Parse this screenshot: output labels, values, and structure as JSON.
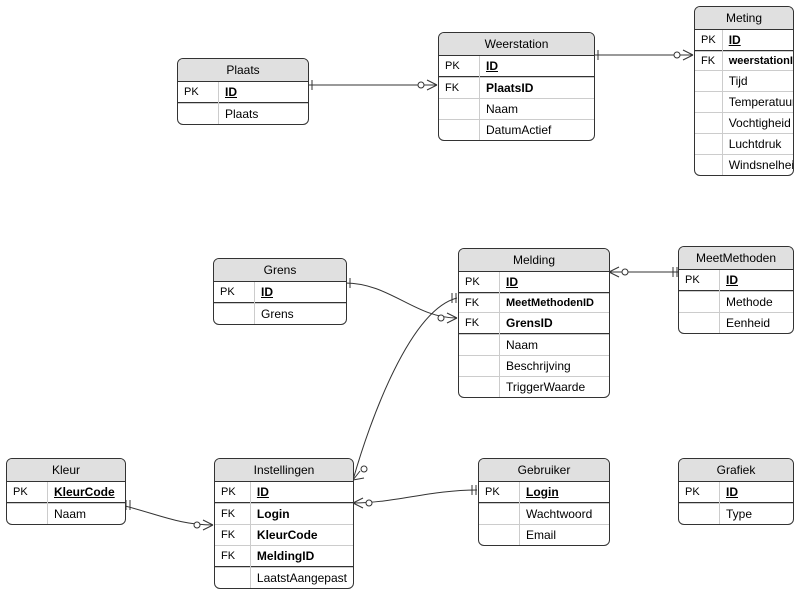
{
  "entities": {
    "plaats": {
      "title": "Plaats",
      "rows": [
        {
          "key": "PK",
          "name": "ID",
          "pk": true
        },
        {
          "key": "",
          "name": "Plaats"
        }
      ]
    },
    "weerstation": {
      "title": "Weerstation",
      "rows": [
        {
          "key": "PK",
          "name": "ID",
          "pk": true
        },
        {
          "key": "FK",
          "name": "PlaatsID",
          "fk": true
        },
        {
          "key": "",
          "name": "Naam"
        },
        {
          "key": "",
          "name": "DatumActief"
        }
      ]
    },
    "meting": {
      "title": "Meting",
      "rows": [
        {
          "key": "PK",
          "name": "ID",
          "pk": true
        },
        {
          "key": "FK",
          "name": "weerstationID",
          "fk": true
        },
        {
          "key": "",
          "name": "Tijd"
        },
        {
          "key": "",
          "name": "Temperatuur"
        },
        {
          "key": "",
          "name": "Vochtigheid"
        },
        {
          "key": "",
          "name": "Luchtdruk"
        },
        {
          "key": "",
          "name": "Windsnelheid"
        }
      ]
    },
    "grens": {
      "title": "Grens",
      "rows": [
        {
          "key": "PK",
          "name": "ID",
          "pk": true
        },
        {
          "key": "",
          "name": "Grens"
        }
      ]
    },
    "melding": {
      "title": "Melding",
      "rows": [
        {
          "key": "PK",
          "name": "ID",
          "pk": true
        },
        {
          "key": "FK",
          "name": "MeetMethodenID",
          "fk": true
        },
        {
          "key": "FK",
          "name": "GrensID",
          "fk": true
        },
        {
          "key": "",
          "name": "Naam"
        },
        {
          "key": "",
          "name": "Beschrijving"
        },
        {
          "key": "",
          "name": "TriggerWaarde"
        }
      ]
    },
    "meetmethoden": {
      "title": "MeetMethoden",
      "rows": [
        {
          "key": "PK",
          "name": "ID",
          "pk": true
        },
        {
          "key": "",
          "name": "Methode"
        },
        {
          "key": "",
          "name": "Eenheid"
        }
      ]
    },
    "kleur": {
      "title": "Kleur",
      "rows": [
        {
          "key": "PK",
          "name": "KleurCode",
          "pk": true,
          "fk": true
        },
        {
          "key": "",
          "name": "Naam"
        }
      ]
    },
    "instellingen": {
      "title": "Instellingen",
      "rows": [
        {
          "key": "PK",
          "name": "ID",
          "pk": true
        },
        {
          "key": "FK",
          "name": "Login",
          "fk": true
        },
        {
          "key": "FK",
          "name": "KleurCode",
          "fk": true
        },
        {
          "key": "FK",
          "name": "MeldingID",
          "fk": true
        },
        {
          "key": "",
          "name": "LaatstAangepast"
        }
      ]
    },
    "gebruiker": {
      "title": "Gebruiker",
      "rows": [
        {
          "key": "PK",
          "name": "Login",
          "pk": true,
          "fk": true
        },
        {
          "key": "",
          "name": "Wachtwoord"
        },
        {
          "key": "",
          "name": "Email"
        }
      ]
    },
    "grafiek": {
      "title": "Grafiek",
      "rows": [
        {
          "key": "PK",
          "name": "ID",
          "pk": true
        },
        {
          "key": "",
          "name": "Type"
        }
      ]
    }
  }
}
